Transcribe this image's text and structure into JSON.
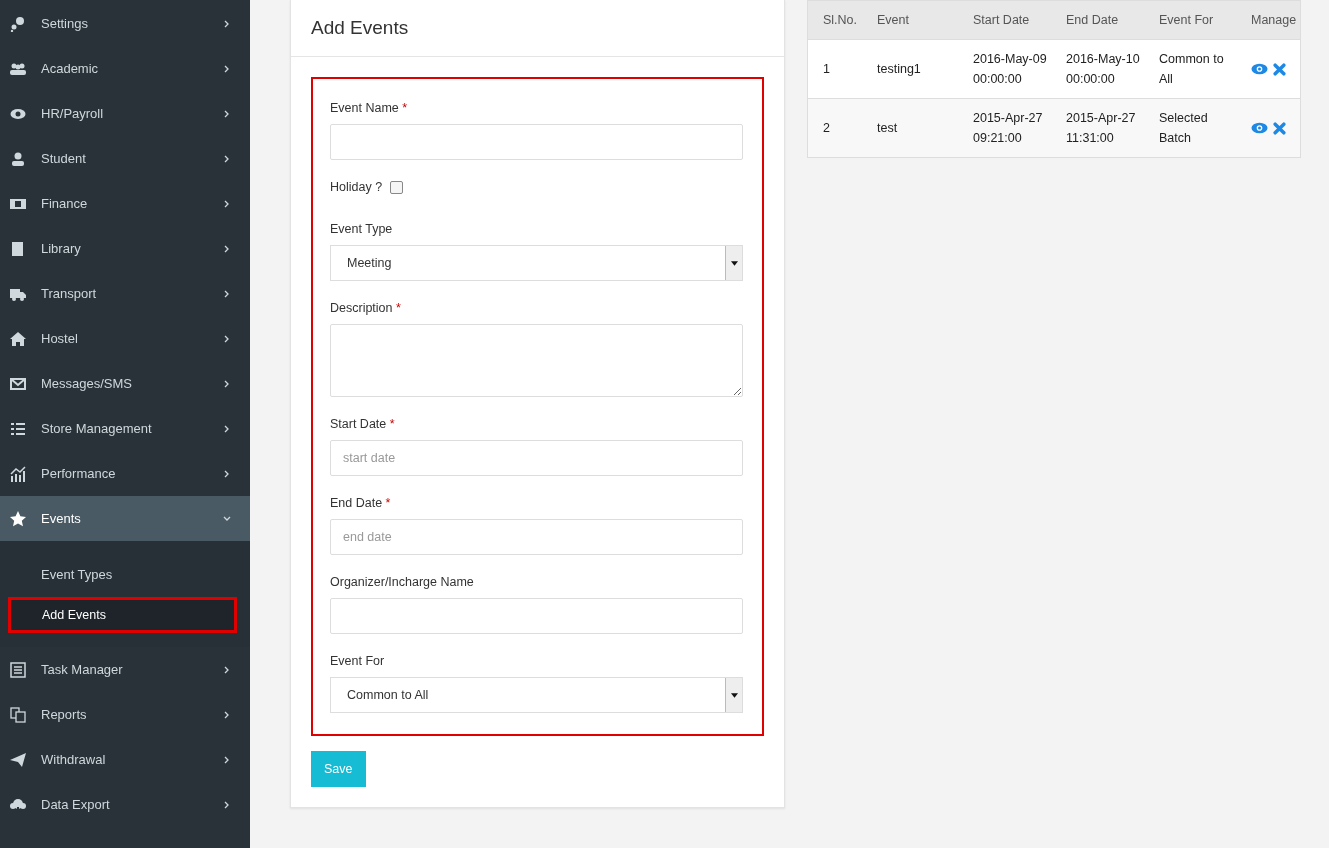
{
  "sidebar": {
    "items": [
      {
        "label": "Settings",
        "expanded": false
      },
      {
        "label": "Academic",
        "expanded": false
      },
      {
        "label": "HR/Payroll",
        "expanded": false
      },
      {
        "label": "Student",
        "expanded": false
      },
      {
        "label": "Finance",
        "expanded": false
      },
      {
        "label": "Library",
        "expanded": false
      },
      {
        "label": "Transport",
        "expanded": false
      },
      {
        "label": "Hostel",
        "expanded": false
      },
      {
        "label": "Messages/SMS",
        "expanded": false
      },
      {
        "label": "Store Management",
        "expanded": false
      },
      {
        "label": "Performance",
        "expanded": false
      },
      {
        "label": "Events",
        "expanded": true,
        "children": [
          {
            "label": "Event Types",
            "selected": false,
            "annotated": false
          },
          {
            "label": "Add Events",
            "selected": true,
            "annotated": true
          }
        ]
      },
      {
        "label": "Task Manager",
        "expanded": false
      },
      {
        "label": "Reports",
        "expanded": false
      },
      {
        "label": "Withdrawal",
        "expanded": false
      },
      {
        "label": "Data Export",
        "expanded": false
      }
    ]
  },
  "form": {
    "title": "Add Events",
    "annotated": true,
    "fields": [
      {
        "kind": "text",
        "label": "Event Name",
        "marker": "*"
      },
      {
        "kind": "checkbox",
        "label": "Holiday ?",
        "checked": false
      },
      {
        "kind": "select",
        "label": "Event Type",
        "value": "Meeting"
      },
      {
        "kind": "textarea",
        "label": "Description",
        "marker": "*"
      },
      {
        "kind": "text",
        "label": "Start Date",
        "marker": "*",
        "placeholder": "start date"
      },
      {
        "kind": "text",
        "label": "End Date",
        "marker": "*",
        "placeholder": "end date"
      },
      {
        "kind": "text",
        "label": "Organizer/Incharge Name"
      },
      {
        "kind": "select",
        "label": "Event For",
        "value": "Common to All"
      }
    ],
    "save_button": "Save"
  },
  "table": {
    "columns": [
      "Sl.No.",
      "Event",
      "Start Date",
      "End Date",
      "Event For",
      "Manage"
    ],
    "rows": [
      {
        "cells": [
          "1",
          "testing1",
          "2016-May-09 00:00:00",
          "2016-May-10 00:00:00",
          "Common to All"
        ]
      },
      {
        "cells": [
          "2",
          "test",
          "2015-Apr-27 09:21:00",
          "2015-Apr-27 11:31:00",
          "Selected Batch"
        ]
      }
    ]
  }
}
